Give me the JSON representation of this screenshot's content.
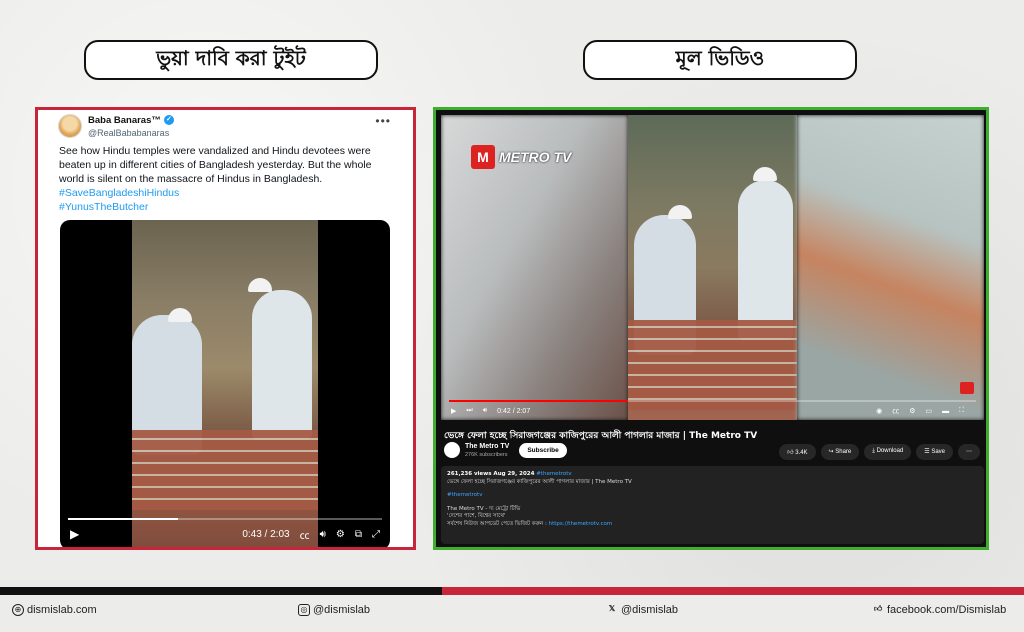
{
  "headings": {
    "left": "ভুয়া দাবি করা টুইট",
    "right": "মূল ভিডিও"
  },
  "tweet": {
    "name": "Baba Banaras™",
    "handle": "@RealBababanaras",
    "more": "•••",
    "text": "See how Hindu temples were vandalized and Hindu devotees were beaten up in different cities of Bangladesh yesterday. But the whole world is silent on the massacre of Hindus in Bangladesh.",
    "hashtags": [
      "#SaveBangladeshiHindus",
      "#YunusTheButcher"
    ],
    "video": {
      "time": "0:43 / 2:03",
      "progress": 0.35
    }
  },
  "youtube": {
    "logo_text": "METRO TV",
    "title": "ভেঙ্গে ফেলা হচ্ছে সিরাজগঞ্জের কাজিপুরের আলী পাগলার মাজার | The Metro TV",
    "time": "0:42 / 2:07",
    "progress": 0.34,
    "channel": {
      "name": "The Metro TV",
      "subscribers": "276K subscribers",
      "subscribe_label": "Subscribe"
    },
    "actions": {
      "likes": "3.4K",
      "share": "Share",
      "download": "Download",
      "save": "Save"
    },
    "description": {
      "meta": "261,236 views  Aug 29, 2024",
      "meta_tag": "#themetrotv",
      "line1": "ভেঙ্গে ফেলা হচ্ছে সিরাজগঞ্জের কাজিপুরের আলী পাগলার মাজার | The Metro TV",
      "tag": "#themetrotv",
      "line2": "The Metro TV - দ্য মেট্রো টিভি",
      "line3": "'দেশের পাশে, বিশ্বের সাথে'",
      "line4": "সর্বশেষ নিউজ আপডেট পেতে ভিজিট করুন :",
      "link": "https://themetrotv.com"
    }
  },
  "footer": {
    "website": "dismislab.com",
    "instagram": "@dismislab",
    "x": "@dismislab",
    "facebook": "facebook.com/Dismislab"
  },
  "icons": {
    "globe": "globe-icon",
    "instagram": "instagram-icon",
    "x": "x-icon",
    "facebook": "facebook-like-icon"
  },
  "colors": {
    "fake_border": "#c8243a",
    "real_border": "#3fae2f",
    "link": "#1d9bf0"
  }
}
